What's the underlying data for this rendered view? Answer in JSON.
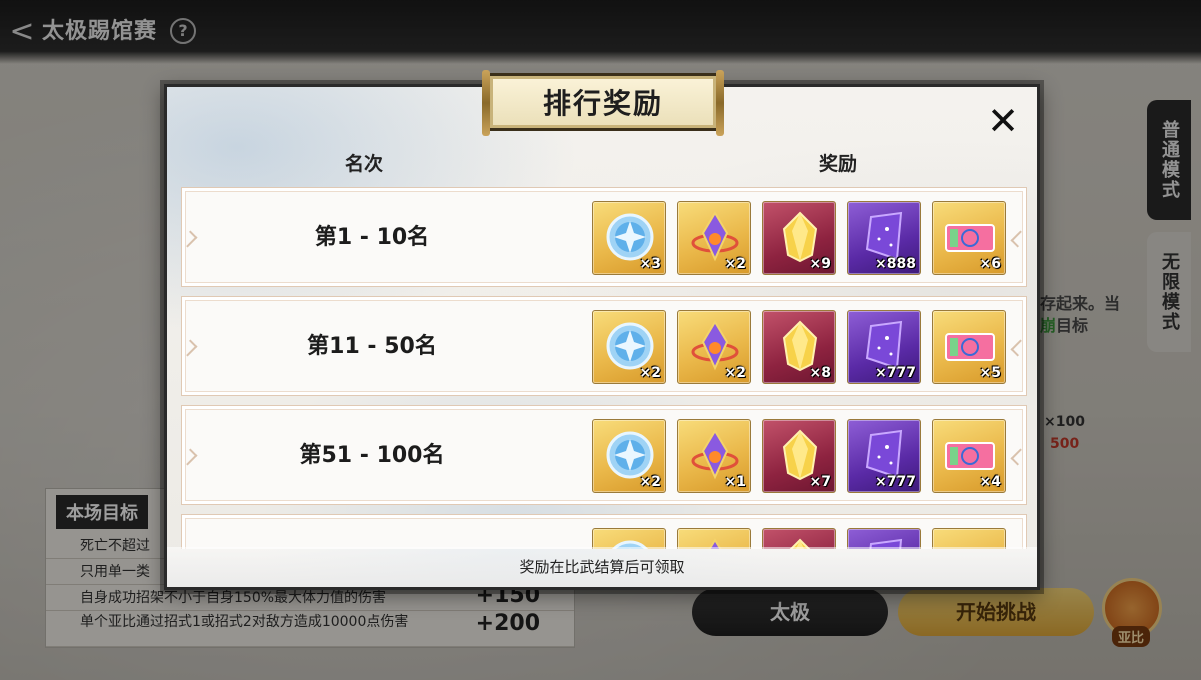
{
  "header": {
    "title": "太极踢馆赛",
    "back_glyph": "<",
    "help_glyph": "?"
  },
  "modes": {
    "normal": "普通模式",
    "endless": "无限模式"
  },
  "background": {
    "text_line1": "存起来。当",
    "text_line2_hl": "崩",
    "text_line2_rest": "目标",
    "cost_count": "×100",
    "cost_value": "500"
  },
  "objectives": {
    "title": "本场目标",
    "rows": [
      {
        "text": "死亡不超过",
        "points": ""
      },
      {
        "text": "只用单一类",
        "points": ""
      },
      {
        "text": "自身成功招架不小于自身150%最大体力值的伤害",
        "points": "+150"
      },
      {
        "text": "单个亚比通过招式1或招式2对敌方造成10000点伤害",
        "points": "+200"
      }
    ]
  },
  "buttons": {
    "taiji": "太极",
    "start": "开始挑战",
    "avatar_name": "亚比"
  },
  "modal": {
    "title": "排行奖励",
    "close_glyph": "✕",
    "col_rank": "名次",
    "col_reward": "奖励",
    "footer": "奖励在比武结算后可领取",
    "rows": [
      {
        "rank": "第1 - 10名",
        "rewards": [
          {
            "icon": "blue-gem-icon",
            "color": "gold",
            "count": "×3"
          },
          {
            "icon": "purple-crystal-icon",
            "color": "gold",
            "count": "×2"
          },
          {
            "icon": "gold-crystal-icon",
            "color": "red",
            "count": "×9"
          },
          {
            "icon": "star-shard-icon",
            "color": "purple",
            "count": "×888"
          },
          {
            "icon": "ticket-icon",
            "color": "gold",
            "count": "×6"
          }
        ]
      },
      {
        "rank": "第11 - 50名",
        "rewards": [
          {
            "icon": "blue-gem-icon",
            "color": "gold",
            "count": "×2"
          },
          {
            "icon": "purple-crystal-icon",
            "color": "gold",
            "count": "×2"
          },
          {
            "icon": "gold-crystal-icon",
            "color": "red",
            "count": "×8"
          },
          {
            "icon": "star-shard-icon",
            "color": "purple",
            "count": "×777"
          },
          {
            "icon": "ticket-icon",
            "color": "gold",
            "count": "×5"
          }
        ]
      },
      {
        "rank": "第51 - 100名",
        "rewards": [
          {
            "icon": "blue-gem-icon",
            "color": "gold",
            "count": "×2"
          },
          {
            "icon": "purple-crystal-icon",
            "color": "gold",
            "count": "×1"
          },
          {
            "icon": "gold-crystal-icon",
            "color": "red",
            "count": "×7"
          },
          {
            "icon": "star-shard-icon",
            "color": "purple",
            "count": "×777"
          },
          {
            "icon": "ticket-icon",
            "color": "gold",
            "count": "×4"
          }
        ]
      },
      {
        "rank": "",
        "rewards": [
          {
            "icon": "blue-gem-icon",
            "color": "gold",
            "count": ""
          },
          {
            "icon": "purple-crystal-icon",
            "color": "gold",
            "count": ""
          },
          {
            "icon": "gold-crystal-icon",
            "color": "red",
            "count": ""
          },
          {
            "icon": "star-shard-icon",
            "color": "purple",
            "count": ""
          },
          {
            "icon": "ticket-icon",
            "color": "gold",
            "count": ""
          }
        ]
      }
    ]
  }
}
